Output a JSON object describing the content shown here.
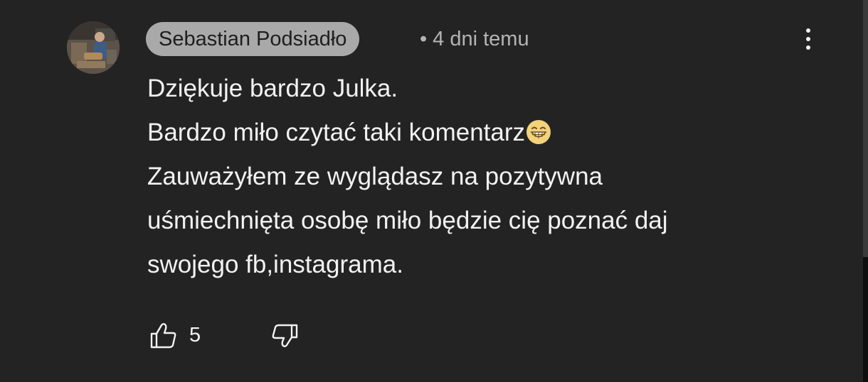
{
  "comment": {
    "author": "Sebastian Podsiadło",
    "separator": "•",
    "time_ago": "4 dni temu",
    "lines": [
      "Dziękuje bardzo Julka.",
      "Bardzo miło czytać taki komentarz",
      "Zauważyłem ze wyglądasz na pozytywna",
      "uśmiechnięta osobę miło będzie cię poznać daj",
      "swojego fb,instagrama."
    ],
    "emoji": "grinning-face-with-smiling-eyes",
    "like_count": "5"
  },
  "icons": {
    "like": "thumbs-up-icon",
    "dislike": "thumbs-down-icon",
    "more": "more-vertical-icon"
  },
  "colors": {
    "background": "#232323",
    "author_chip": "#a9a9a9",
    "text": "#f2f2f2",
    "meta_text": "#b4b4b4"
  }
}
